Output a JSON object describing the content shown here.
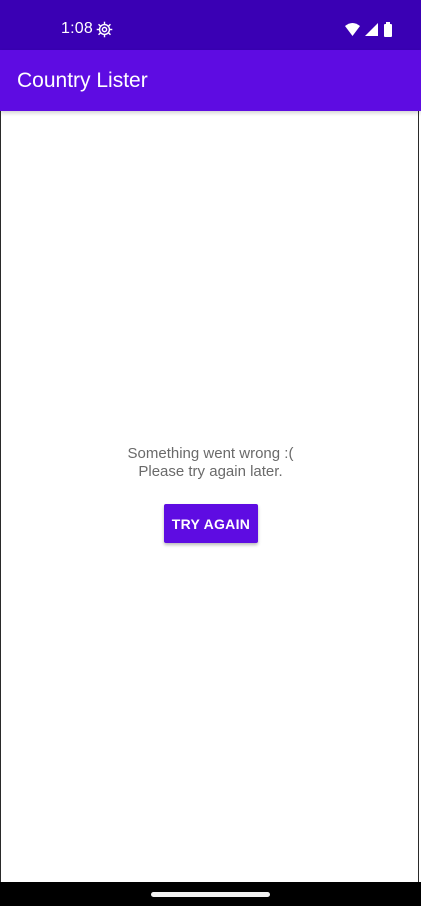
{
  "status_bar": {
    "time": "1:08",
    "icons": [
      "settings-gear-icon",
      "wifi-icon",
      "cell-signal-icon",
      "battery-icon"
    ],
    "background": "#3a00b4"
  },
  "app_bar": {
    "title": "Country Lister",
    "background": "#5e0ce2"
  },
  "error": {
    "line1": "Something went wrong :(",
    "line2": "Please try again later.",
    "text_color": "#6a6a6a"
  },
  "retry_button": {
    "label": "TRY AGAIN",
    "background": "#5e0ce2"
  },
  "navigation": {
    "handle": "home-handle"
  }
}
